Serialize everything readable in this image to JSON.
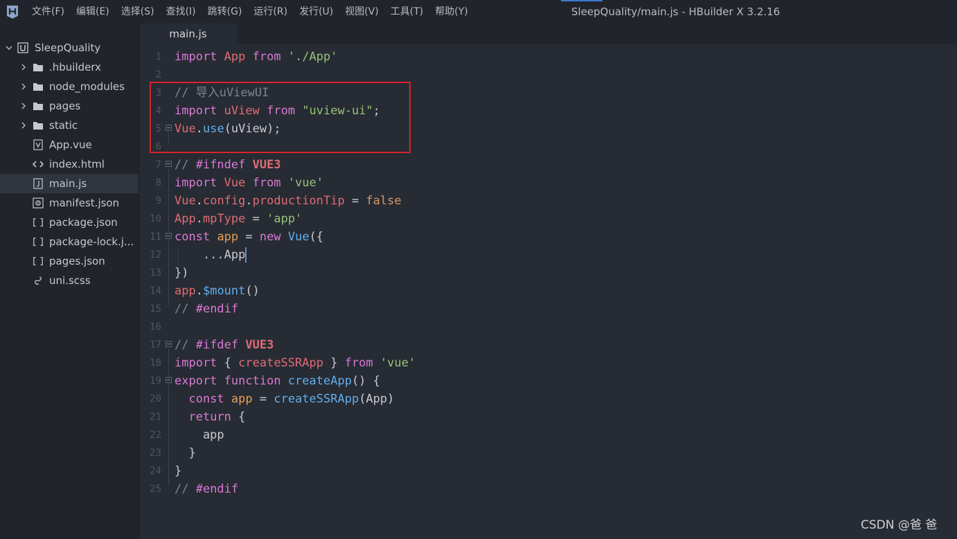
{
  "app": {
    "window_title": "SleepQuality/main.js - HBuilder X 3.2.16",
    "logo_icon": "hbuilderx-logo-icon"
  },
  "menu": [
    {
      "label": "文件(F)"
    },
    {
      "label": "编辑(E)"
    },
    {
      "label": "选择(S)"
    },
    {
      "label": "查找(I)"
    },
    {
      "label": "跳转(G)"
    },
    {
      "label": "运行(R)"
    },
    {
      "label": "发行(U)"
    },
    {
      "label": "视图(V)"
    },
    {
      "label": "工具(T)"
    },
    {
      "label": "帮助(Y)"
    }
  ],
  "sidebar": {
    "project": {
      "label": "SleepQuality",
      "expanded": true,
      "icon": "uniapp-project-icon"
    },
    "items": [
      {
        "label": ".hbuilderx",
        "type": "folder",
        "icon": "folder-icon"
      },
      {
        "label": "node_modules",
        "type": "folder",
        "icon": "folder-icon"
      },
      {
        "label": "pages",
        "type": "folder",
        "icon": "folder-icon"
      },
      {
        "label": "static",
        "type": "folder",
        "icon": "folder-icon"
      },
      {
        "label": "App.vue",
        "type": "file",
        "icon": "vue-file-icon"
      },
      {
        "label": "index.html",
        "type": "file",
        "icon": "html-file-icon"
      },
      {
        "label": "main.js",
        "type": "file",
        "icon": "js-file-icon",
        "selected": true
      },
      {
        "label": "manifest.json",
        "type": "file",
        "icon": "manifest-file-icon"
      },
      {
        "label": "package.json",
        "type": "file",
        "icon": "json-file-icon"
      },
      {
        "label": "package-lock.j...",
        "type": "file",
        "icon": "json-file-icon"
      },
      {
        "label": "pages.json",
        "type": "file",
        "icon": "json-file-icon"
      },
      {
        "label": "uni.scss",
        "type": "file",
        "icon": "scss-file-icon"
      }
    ]
  },
  "editor": {
    "active_tab": "main.js",
    "lines": [
      {
        "n": "1",
        "tokens": [
          {
            "t": "import",
            "c": "kw"
          },
          {
            "t": " ",
            "c": "txt"
          },
          {
            "t": "App",
            "c": "def"
          },
          {
            "t": " ",
            "c": "txt"
          },
          {
            "t": "from",
            "c": "kw"
          },
          {
            "t": " ",
            "c": "txt"
          },
          {
            "t": "'./App'",
            "c": "str"
          }
        ]
      },
      {
        "n": "2",
        "tokens": []
      },
      {
        "n": "3",
        "tokens": [
          {
            "t": "// 导入uViewUI",
            "c": "cm"
          }
        ]
      },
      {
        "n": "4",
        "tokens": [
          {
            "t": "import",
            "c": "kw"
          },
          {
            "t": " ",
            "c": "txt"
          },
          {
            "t": "uView",
            "c": "def"
          },
          {
            "t": " ",
            "c": "txt"
          },
          {
            "t": "from",
            "c": "kw"
          },
          {
            "t": " ",
            "c": "txt"
          },
          {
            "t": "\"uview-ui\"",
            "c": "str"
          },
          {
            "t": ";",
            "c": "txt"
          }
        ]
      },
      {
        "n": "5",
        "fold": true,
        "tokens": [
          {
            "t": "Vue",
            "c": "def"
          },
          {
            "t": ".",
            "c": "txt"
          },
          {
            "t": "use",
            "c": "fn"
          },
          {
            "t": "(uView);",
            "c": "txt"
          }
        ]
      },
      {
        "n": "6",
        "tokens": []
      },
      {
        "n": "7",
        "fold": true,
        "tokens": [
          {
            "t": "// ",
            "c": "cm"
          },
          {
            "t": "#ifndef",
            "c": "kw"
          },
          {
            "t": " ",
            "c": "txt"
          },
          {
            "t": "VUE3",
            "c": "mac"
          }
        ]
      },
      {
        "n": "8",
        "tokens": [
          {
            "t": "import",
            "c": "kw"
          },
          {
            "t": " ",
            "c": "txt"
          },
          {
            "t": "Vue",
            "c": "def"
          },
          {
            "t": " ",
            "c": "txt"
          },
          {
            "t": "from",
            "c": "kw"
          },
          {
            "t": " ",
            "c": "txt"
          },
          {
            "t": "'vue'",
            "c": "str"
          }
        ]
      },
      {
        "n": "9",
        "tokens": [
          {
            "t": "Vue",
            "c": "def"
          },
          {
            "t": ".",
            "c": "txt"
          },
          {
            "t": "config",
            "c": "def"
          },
          {
            "t": ".",
            "c": "txt"
          },
          {
            "t": "productionTip",
            "c": "def"
          },
          {
            "t": " = ",
            "c": "txt"
          },
          {
            "t": "false",
            "c": "bool"
          }
        ]
      },
      {
        "n": "10",
        "tokens": [
          {
            "t": "App",
            "c": "def"
          },
          {
            "t": ".",
            "c": "txt"
          },
          {
            "t": "mpType",
            "c": "def"
          },
          {
            "t": " = ",
            "c": "txt"
          },
          {
            "t": "'app'",
            "c": "str"
          }
        ]
      },
      {
        "n": "11",
        "fold": true,
        "tokens": [
          {
            "t": "const",
            "c": "kw"
          },
          {
            "t": " ",
            "c": "txt"
          },
          {
            "t": "app",
            "c": "var"
          },
          {
            "t": " = ",
            "c": "txt"
          },
          {
            "t": "new",
            "c": "kw"
          },
          {
            "t": " ",
            "c": "txt"
          },
          {
            "t": "Vue",
            "c": "fn"
          },
          {
            "t": "({",
            "c": "txt"
          }
        ]
      },
      {
        "n": "12",
        "tokens": [
          {
            "t": "    ...App",
            "c": "txt"
          }
        ]
      },
      {
        "n": "13",
        "tokens": [
          {
            "t": "})",
            "c": "txt"
          }
        ]
      },
      {
        "n": "14",
        "tokens": [
          {
            "t": "app",
            "c": "def"
          },
          {
            "t": ".",
            "c": "txt"
          },
          {
            "t": "$mount",
            "c": "fn"
          },
          {
            "t": "()",
            "c": "txt"
          }
        ]
      },
      {
        "n": "15",
        "tokens": [
          {
            "t": "// ",
            "c": "cm"
          },
          {
            "t": "#endif",
            "c": "kw"
          }
        ]
      },
      {
        "n": "16",
        "tokens": []
      },
      {
        "n": "17",
        "fold": true,
        "tokens": [
          {
            "t": "// ",
            "c": "cm"
          },
          {
            "t": "#ifdef",
            "c": "kw"
          },
          {
            "t": " ",
            "c": "txt"
          },
          {
            "t": "VUE3",
            "c": "mac"
          }
        ]
      },
      {
        "n": "18",
        "tokens": [
          {
            "t": "import",
            "c": "kw"
          },
          {
            "t": " { ",
            "c": "txt"
          },
          {
            "t": "createSSRApp",
            "c": "def"
          },
          {
            "t": " } ",
            "c": "txt"
          },
          {
            "t": "from",
            "c": "kw"
          },
          {
            "t": " ",
            "c": "txt"
          },
          {
            "t": "'vue'",
            "c": "str"
          }
        ]
      },
      {
        "n": "19",
        "fold": true,
        "tokens": [
          {
            "t": "export",
            "c": "kw"
          },
          {
            "t": " ",
            "c": "txt"
          },
          {
            "t": "function",
            "c": "kw"
          },
          {
            "t": " ",
            "c": "txt"
          },
          {
            "t": "createApp",
            "c": "fn"
          },
          {
            "t": "() {",
            "c": "txt"
          }
        ]
      },
      {
        "n": "20",
        "tokens": [
          {
            "t": "  ",
            "c": "txt"
          },
          {
            "t": "const",
            "c": "kw"
          },
          {
            "t": " ",
            "c": "txt"
          },
          {
            "t": "app",
            "c": "var"
          },
          {
            "t": " = ",
            "c": "txt"
          },
          {
            "t": "createSSRApp",
            "c": "fn"
          },
          {
            "t": "(App)",
            "c": "txt"
          }
        ]
      },
      {
        "n": "21",
        "tokens": [
          {
            "t": "  ",
            "c": "txt"
          },
          {
            "t": "return",
            "c": "kw"
          },
          {
            "t": " {",
            "c": "txt"
          }
        ]
      },
      {
        "n": "22",
        "tokens": [
          {
            "t": "    app",
            "c": "txt"
          }
        ]
      },
      {
        "n": "23",
        "tokens": [
          {
            "t": "  }",
            "c": "txt"
          }
        ]
      },
      {
        "n": "24",
        "tokens": [
          {
            "t": "}",
            "c": "txt"
          }
        ]
      },
      {
        "n": "25",
        "tokens": [
          {
            "t": "// ",
            "c": "cm"
          },
          {
            "t": "#endif",
            "c": "kw"
          }
        ]
      }
    ],
    "cursor_line": "12"
  },
  "watermark": "CSDN @爸  爸",
  "colors": {
    "background": "#272b33",
    "sidebar": "#21252b",
    "highlight_box": "#d9232a",
    "keyword": "#d97ad6",
    "string": "#98c379",
    "comment": "#7f848e",
    "function": "#61afef"
  }
}
